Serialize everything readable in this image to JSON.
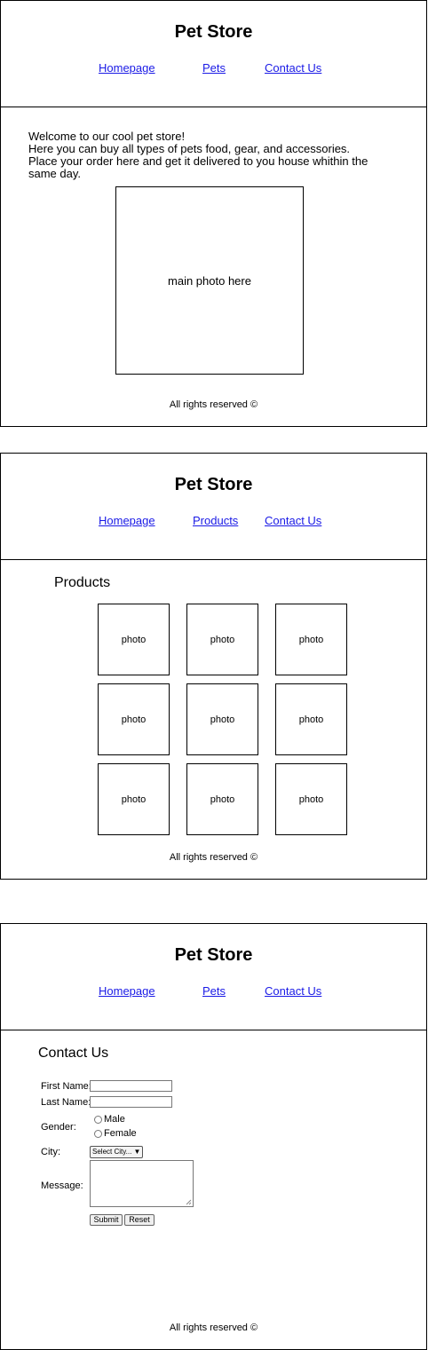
{
  "site": {
    "title": "Pet Store",
    "footer": "All rights reserved ©"
  },
  "page1": {
    "nav": [
      "Homepage",
      "Pets",
      "Contact Us"
    ],
    "intro": [
      "Welcome to our cool pet store!",
      "Here you can buy all types of pets food, gear, and accessories.",
      "Place your order here and get it delivered to you house whithin the same day."
    ],
    "main_photo": "main photo here"
  },
  "page2": {
    "nav": [
      "Homepage",
      "Products",
      "Contact Us"
    ],
    "heading": "Products",
    "photos": [
      "photo",
      "photo",
      "photo",
      "photo",
      "photo",
      "photo",
      "photo",
      "photo",
      "photo"
    ]
  },
  "page3": {
    "nav": [
      "Homepage",
      "Pets",
      "Contact Us"
    ],
    "heading": "Contact Us",
    "form": {
      "first_name_label": "First Name:",
      "last_name_label": "Last Name:",
      "gender_label": "Gender:",
      "gender_options": [
        "Male",
        "Female"
      ],
      "city_label": "City:",
      "city_selected": "Select City...",
      "message_label": "Message:",
      "submit": "Submit",
      "reset": "Reset"
    }
  }
}
